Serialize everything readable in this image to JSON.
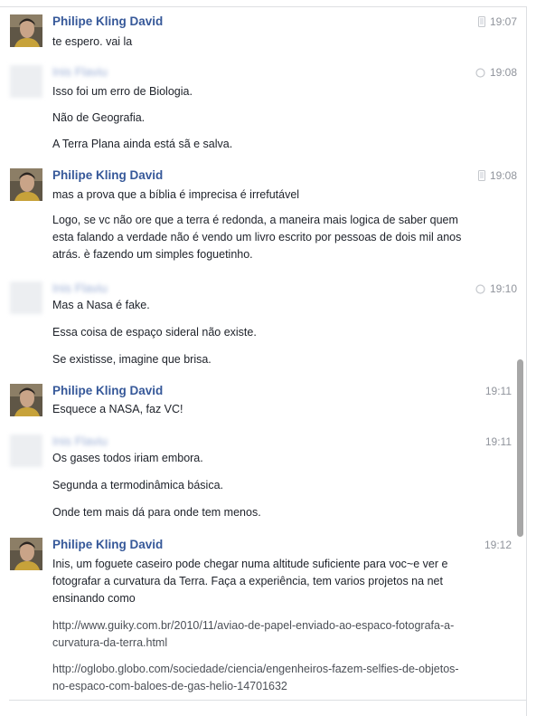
{
  "messages": [
    {
      "sender": "Philipe Kling David",
      "sender_blurred": false,
      "time": "19:07",
      "status_icon": "phone-icon",
      "texts": [
        "te espero. vai la"
      ]
    },
    {
      "sender": "Inis Flaviu",
      "sender_blurred": true,
      "time": "19:08",
      "status_icon": "sent-circle-icon",
      "texts": [
        "Isso foi um erro de Biologia.",
        "Não de Geografia.",
        "A Terra Plana ainda está sã e salva."
      ]
    },
    {
      "sender": "Philipe Kling David",
      "sender_blurred": false,
      "time": "19:08",
      "status_icon": "phone-icon",
      "texts": [
        "mas a prova que a bíblia é imprecisa é irrefutável",
        "Logo, se vc não ore que a terra é redonda, a maneira mais logica de saber quem esta falando a verdade não é vendo um livro escrito por pessoas de dois mil anos atrás. è fazendo um simples foguetinho."
      ]
    },
    {
      "sender": "Inis Flaviu",
      "sender_blurred": true,
      "time": "19:10",
      "status_icon": "sent-circle-icon",
      "texts": [
        "Mas a Nasa é fake.",
        "Essa coisa de espaço sideral não existe.",
        "Se existisse, imagine que brisa."
      ]
    },
    {
      "sender": "Philipe Kling David",
      "sender_blurred": false,
      "time": "19:11",
      "status_icon": "",
      "texts": [
        "Esquece a NASA, faz VC!"
      ]
    },
    {
      "sender": "Inis Flaviu",
      "sender_blurred": true,
      "time": "19:11",
      "status_icon": "",
      "texts": [
        "Os gases todos iriam embora.",
        "Segunda a termodinâmica básica.",
        "Onde tem mais dá para onde tem menos."
      ]
    },
    {
      "sender": "Philipe Kling David",
      "sender_blurred": false,
      "time": "19:12",
      "status_icon": "",
      "texts": [
        "Inis, um foguete caseiro pode chegar numa altitude suficiente para voc~e ver e fotografar a curvatura da Terra. Faça a experiência, tem varios projetos na net ensinando como"
      ],
      "links": [
        "http://www.guiky.com.br/2010/11/aviao-de-papel-enviado-ao-espaco-fotografa-a-curvatura-da-terra.html",
        "http://oglobo.globo.com/sociedade/ciencia/engenheiros-fazem-selfies-de-objetos-no-espaco-com-baloes-de-gas-helio-14701632"
      ]
    }
  ]
}
